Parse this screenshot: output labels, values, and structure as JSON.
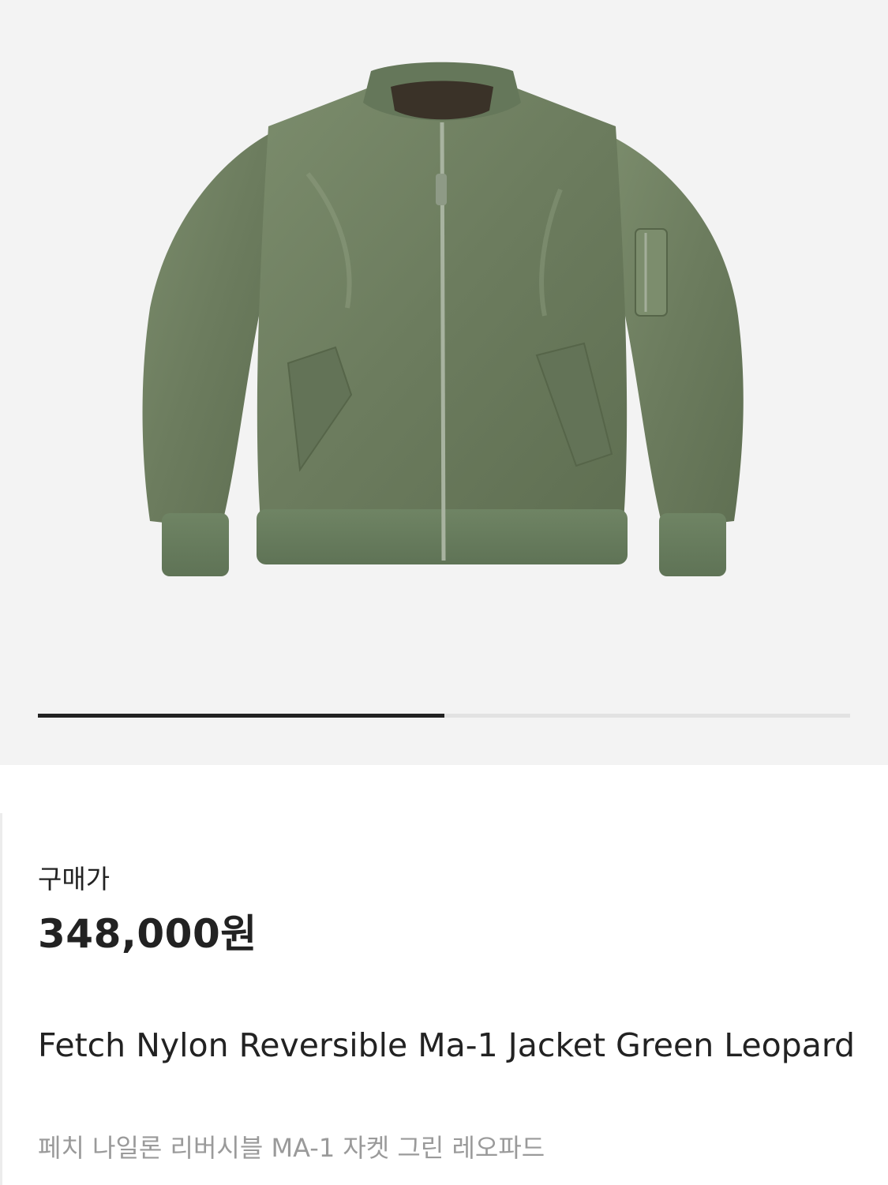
{
  "product": {
    "image_icon": "green-bomber-jacket-image",
    "image_progress": 0.5,
    "price_label": "구매가",
    "price": "348,000원",
    "name_en": "Fetch Nylon Reversible Ma-1 Jacket Green Leopard",
    "name_ko": "페치 나일론 리버시블 MA-1 자켓 그린 레오파드"
  },
  "colors": {
    "hero_background": "#f3f3f3",
    "jacket": "#6f8061",
    "progress_track": "#e2e2e2",
    "progress_fill": "#222222",
    "text_primary": "#222222",
    "text_secondary": "#9a9a9a"
  }
}
